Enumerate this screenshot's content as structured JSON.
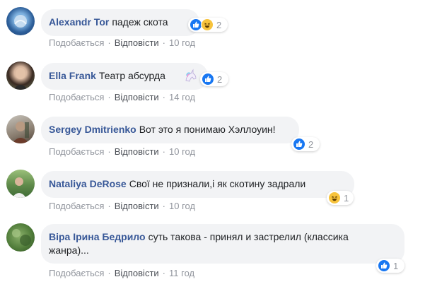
{
  "comments": [
    {
      "author": "Alexandr Tor",
      "text": "падеж скота",
      "reactions": [
        "like-icon",
        "haha-icon"
      ],
      "reaction_count": "2",
      "like_label": "Подобається",
      "reply_label": "Відповісти",
      "time": "10 год"
    },
    {
      "author": "Ella Frank",
      "text": "Театр абсурда",
      "emoji": "unicorn-icon",
      "reactions": [
        "like-icon"
      ],
      "reaction_count": "2",
      "like_label": "Подобається",
      "reply_label": "Відповісти",
      "time": "14 год"
    },
    {
      "author": "Sergey Dmitrienko",
      "text": "Вот это я понимаю Хэллоуин!",
      "reactions": [
        "like-icon"
      ],
      "reaction_count": "2",
      "like_label": "Подобається",
      "reply_label": "Відповісти",
      "time": "10 год"
    },
    {
      "author": "Nataliya DeRose",
      "text": "Свої не признали,і як скотину задрали",
      "reactions": [
        "haha-icon"
      ],
      "reaction_count": "1",
      "like_label": "Подобається",
      "reply_label": "Відповісти",
      "time": "10 год"
    },
    {
      "author": "Віра Ірина Бедрило",
      "text_line1": "суть такова - принял и застрелил (классика",
      "text_line2": "жанра)...",
      "reactions": [
        "like-icon"
      ],
      "reaction_count": "1",
      "like_label": "Подобається",
      "reply_label": "Відповісти",
      "time": "11 год"
    }
  ],
  "colors": {
    "author": "#385898",
    "bubble": "#f2f3f5",
    "meta": "#90949c",
    "like": "#1877f2",
    "haha": "#f7c33c"
  }
}
